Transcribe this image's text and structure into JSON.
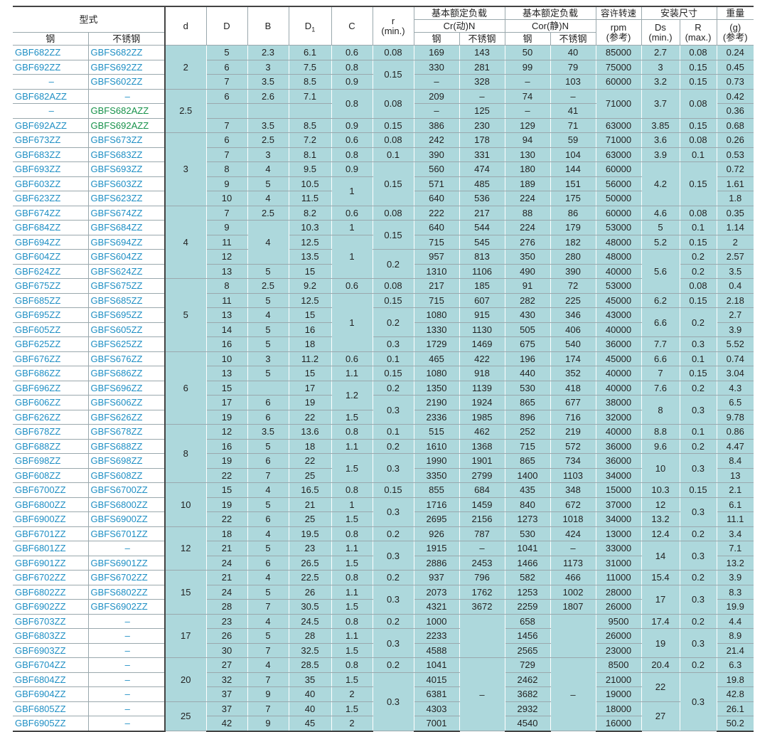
{
  "header": {
    "type": "型式",
    "steel": "钢",
    "stainless": "不锈钢",
    "d": "d",
    "D": "D",
    "B": "B",
    "D1": "D",
    "D1_sub": "1",
    "C": "C",
    "r": "r",
    "r_unit": "(min.)",
    "dyn_load": "基本额定负载",
    "cr": "Cr(动)N",
    "static_load": "基本额定负载",
    "cor": "Cor(静)N",
    "speed": "容许转速",
    "rpm": "rpm",
    "ref1": "(参考)",
    "mount": "安装尺寸",
    "ds": "Ds",
    "ds_unit": "(min.)",
    "R": "R",
    "R_unit": "(max.)",
    "weight": "重量",
    "g": "(g)",
    "ref2": "(参考)",
    "cr_steel": "钢",
    "cr_ss": "不锈钢",
    "cor_steel": "钢",
    "cor_ss": "不锈钢"
  },
  "dash": "–",
  "rows": [
    [
      "GBF682ZZ",
      "GBFS682ZZ",
      "2",
      "5",
      "2.3",
      "6.1",
      "0.6",
      "0.08",
      "169",
      "143",
      "50",
      "40",
      "85000",
      "2.7",
      "0.08",
      "0.24"
    ],
    [
      "GBF692ZZ",
      "GBFS692ZZ",
      "",
      "6",
      "3",
      "7.5",
      "0.8",
      "0.15",
      "330",
      "281",
      "99",
      "79",
      "75000",
      "3",
      "0.15",
      "0.45"
    ],
    [
      "–",
      "GBFS602ZZ",
      "",
      "7",
      "3.5",
      "8.5",
      "0.9",
      "",
      "–",
      "328",
      "–",
      "103",
      "60000",
      "3.2",
      "0.15",
      "0.73"
    ],
    [
      "GBF682AZZ",
      "–",
      "2.5",
      "6",
      "2.6",
      "7.1",
      "0.8",
      "0.08",
      "209",
      "–",
      "74",
      "–",
      "71000",
      "3.7",
      "0.08",
      "0.42"
    ],
    [
      "–",
      "GBFS682AZZ",
      "",
      "",
      "",
      "",
      "",
      "",
      "–",
      "125",
      "–",
      "41",
      "",
      "",
      "",
      "0.36"
    ],
    [
      "GBF692AZZ",
      "GBFS692AZZ",
      "",
      "7",
      "3.5",
      "8.5",
      "0.9",
      "0.15",
      "386",
      "230",
      "129",
      "71",
      "63000",
      "3.85",
      "0.15",
      "0.68"
    ],
    [
      "GBF673ZZ",
      "GBFS673ZZ",
      "3",
      "6",
      "2.5",
      "7.2",
      "0.6",
      "0.08",
      "242",
      "178",
      "94",
      "59",
      "71000",
      "3.6",
      "0.08",
      "0.26"
    ],
    [
      "GBF683ZZ",
      "GBFS683ZZ",
      "",
      "7",
      "3",
      "8.1",
      "0.8",
      "0.1",
      "390",
      "331",
      "130",
      "104",
      "63000",
      "3.9",
      "0.1",
      "0.53"
    ],
    [
      "GBF693ZZ",
      "GBFS693ZZ",
      "",
      "8",
      "4",
      "9.5",
      "0.9",
      "0.15",
      "560",
      "474",
      "180",
      "144",
      "60000",
      "4.2",
      "0.15",
      "0.72"
    ],
    [
      "GBF603ZZ",
      "GBFS603ZZ",
      "",
      "9",
      "5",
      "10.5",
      "1",
      "",
      "571",
      "485",
      "189",
      "151",
      "56000",
      "",
      "",
      "1.61"
    ],
    [
      "GBF623ZZ",
      "GBFS623ZZ",
      "",
      "10",
      "4",
      "11.5",
      "1",
      "",
      "640",
      "536",
      "224",
      "175",
      "50000",
      "",
      "",
      "1.8"
    ],
    [
      "GBF674ZZ",
      "GBFS674ZZ",
      "4",
      "7",
      "2.5",
      "8.2",
      "0.6",
      "0.08",
      "222",
      "217",
      "88",
      "86",
      "60000",
      "4.6",
      "0.08",
      "0.35"
    ],
    [
      "GBF684ZZ",
      "GBFS684ZZ",
      "",
      "9",
      "4",
      "10.3",
      "1",
      "0.15",
      "640",
      "544",
      "224",
      "179",
      "53000",
      "5",
      "0.1",
      "1.14"
    ],
    [
      "GBF694ZZ",
      "GBFS694ZZ",
      "",
      "11",
      "",
      "12.5",
      "1",
      "",
      "715",
      "545",
      "276",
      "182",
      "48000",
      "5.2",
      "0.15",
      "2"
    ],
    [
      "GBF604ZZ",
      "GBFS604ZZ",
      "",
      "12",
      "",
      "13.5",
      "",
      "0.2",
      "957",
      "813",
      "350",
      "280",
      "48000",
      "5.6",
      "0.2",
      "2.57"
    ],
    [
      "GBF624ZZ",
      "GBFS624ZZ",
      "",
      "13",
      "5",
      "15",
      "",
      "",
      "1310",
      "1106",
      "490",
      "390",
      "40000",
      "",
      "0.2",
      "3.5"
    ],
    [
      "GBF675ZZ",
      "GBFS675ZZ",
      "5",
      "8",
      "2.5",
      "9.2",
      "0.6",
      "0.08",
      "217",
      "185",
      "91",
      "72",
      "53000",
      "",
      "0.08",
      "0.4"
    ],
    [
      "GBF685ZZ",
      "GBFS685ZZ",
      "",
      "11",
      "5",
      "12.5",
      "1",
      "0.15",
      "715",
      "607",
      "282",
      "225",
      "45000",
      "6.2",
      "0.15",
      "2.18"
    ],
    [
      "GBF695ZZ",
      "GBFS695ZZ",
      "",
      "13",
      "4",
      "15",
      "",
      "0.2",
      "1080",
      "915",
      "430",
      "346",
      "43000",
      "6.6",
      "0.2",
      "2.7"
    ],
    [
      "GBF605ZZ",
      "GBFS605ZZ",
      "",
      "14",
      "5",
      "16",
      "",
      "",
      "1330",
      "1130",
      "505",
      "406",
      "40000",
      "",
      "",
      "3.9"
    ],
    [
      "GBF625ZZ",
      "GBFS625ZZ",
      "",
      "16",
      "5",
      "18",
      "",
      "0.3",
      "1729",
      "1469",
      "675",
      "540",
      "36000",
      "7.7",
      "0.3",
      "5.52"
    ],
    [
      "GBF676ZZ",
      "GBFS676ZZ",
      "6",
      "10",
      "3",
      "11.2",
      "0.6",
      "0.1",
      "465",
      "422",
      "196",
      "174",
      "45000",
      "6.6",
      "0.1",
      "0.74"
    ],
    [
      "GBF686ZZ",
      "GBFS686ZZ",
      "",
      "13",
      "5",
      "15",
      "1.1",
      "0.15",
      "1080",
      "918",
      "440",
      "352",
      "40000",
      "7",
      "0.15",
      "3.04"
    ],
    [
      "GBF696ZZ",
      "GBFS696ZZ",
      "",
      "15",
      "",
      "17",
      "1.2",
      "0.2",
      "1350",
      "1139",
      "530",
      "418",
      "40000",
      "7.6",
      "0.2",
      "4.3"
    ],
    [
      "GBF606ZZ",
      "GBFS606ZZ",
      "",
      "17",
      "6",
      "19",
      "",
      "0.3",
      "2190",
      "1924",
      "865",
      "677",
      "38000",
      "8",
      "0.3",
      "6.5"
    ],
    [
      "GBF626ZZ",
      "GBFS626ZZ",
      "",
      "19",
      "6",
      "22",
      "1.5",
      "",
      "2336",
      "1985",
      "896",
      "716",
      "32000",
      "",
      "",
      "9.78"
    ],
    [
      "GBF678ZZ",
      "GBFS678ZZ",
      "8",
      "12",
      "3.5",
      "13.6",
      "0.8",
      "0.1",
      "515",
      "462",
      "252",
      "219",
      "40000",
      "8.8",
      "0.1",
      "0.86"
    ],
    [
      "GBF688ZZ",
      "GBFS688ZZ",
      "",
      "16",
      "5",
      "18",
      "1.1",
      "0.2",
      "1610",
      "1368",
      "715",
      "572",
      "36000",
      "9.6",
      "0.2",
      "4.47"
    ],
    [
      "GBF698ZZ",
      "GBFS698ZZ",
      "",
      "19",
      "6",
      "22",
      "1.5",
      "0.3",
      "1990",
      "1901",
      "865",
      "734",
      "36000",
      "10",
      "0.3",
      "8.4"
    ],
    [
      "GBF608ZZ",
      "GBFS608ZZ",
      "",
      "22",
      "7",
      "25",
      "",
      "",
      "3350",
      "2799",
      "1400",
      "1103",
      "34000",
      "",
      "",
      "13"
    ],
    [
      "GBF6700ZZ",
      "GBFS6700ZZ",
      "10",
      "15",
      "4",
      "16.5",
      "0.8",
      "0.15",
      "855",
      "684",
      "435",
      "348",
      "15000",
      "10.3",
      "0.15",
      "2.1"
    ],
    [
      "GBF6800ZZ",
      "GBFS6800ZZ",
      "",
      "19",
      "5",
      "21",
      "1",
      "0.3",
      "1716",
      "1459",
      "840",
      "672",
      "37000",
      "12",
      "0.3",
      "6.1"
    ],
    [
      "GBF6900ZZ",
      "GBFS6900ZZ",
      "",
      "22",
      "6",
      "25",
      "1.5",
      "",
      "2695",
      "2156",
      "1273",
      "1018",
      "34000",
      "13.2",
      "",
      "11.1"
    ],
    [
      "GBF6701ZZ",
      "GBFS6701ZZ",
      "12",
      "18",
      "4",
      "19.5",
      "0.8",
      "0.2",
      "926",
      "787",
      "530",
      "424",
      "13000",
      "12.4",
      "0.2",
      "3.4"
    ],
    [
      "GBF6801ZZ",
      "–",
      "",
      "21",
      "5",
      "23",
      "1.1",
      "0.3",
      "1915",
      "–",
      "1041",
      "–",
      "33000",
      "14",
      "0.3",
      "7.1"
    ],
    [
      "GBF6901ZZ",
      "GBFS6901ZZ",
      "",
      "24",
      "6",
      "26.5",
      "1.5",
      "",
      "2886",
      "2453",
      "1466",
      "1173",
      "31000",
      "",
      "",
      "13.2"
    ],
    [
      "GBF6702ZZ",
      "GBFS6702ZZ",
      "15",
      "21",
      "4",
      "22.5",
      "0.8",
      "0.2",
      "937",
      "796",
      "582",
      "466",
      "11000",
      "15.4",
      "0.2",
      "3.9"
    ],
    [
      "GBF6802ZZ",
      "GBFS6802ZZ",
      "",
      "24",
      "5",
      "26",
      "1.1",
      "0.3",
      "2073",
      "1762",
      "1253",
      "1002",
      "28000",
      "17",
      "0.3",
      "8.3"
    ],
    [
      "GBF6902ZZ",
      "GBFS6902ZZ",
      "",
      "28",
      "7",
      "30.5",
      "1.5",
      "",
      "4321",
      "3672",
      "2259",
      "1807",
      "26000",
      "",
      "",
      "19.9"
    ],
    [
      "GBF6703ZZ",
      "–",
      "17",
      "23",
      "4",
      "24.5",
      "0.8",
      "0.2",
      "1000",
      "",
      "658",
      "",
      "9500",
      "17.4",
      "0.2",
      "4.4"
    ],
    [
      "GBF6803ZZ",
      "–",
      "",
      "26",
      "5",
      "28",
      "1.1",
      "0.3",
      "2233",
      "",
      "1456",
      "",
      "26000",
      "19",
      "0.3",
      "8.9"
    ],
    [
      "GBF6903ZZ",
      "–",
      "",
      "30",
      "7",
      "32.5",
      "1.5",
      "",
      "4588",
      "",
      "2565",
      "",
      "23000",
      "",
      "",
      "21.4"
    ],
    [
      "GBF6704ZZ",
      "–",
      "20",
      "27",
      "4",
      "28.5",
      "0.8",
      "0.2",
      "1041",
      "–",
      "729",
      "–",
      "8500",
      "20.4",
      "0.2",
      "6.3"
    ],
    [
      "GBF6804ZZ",
      "–",
      "",
      "32",
      "7",
      "35",
      "1.5",
      "0.3",
      "4015",
      "",
      "2462",
      "",
      "21000",
      "22",
      "0.3",
      "19.8"
    ],
    [
      "GBF6904ZZ",
      "–",
      "",
      "37",
      "9",
      "40",
      "2",
      "",
      "6381",
      "",
      "3682",
      "",
      "19000",
      "",
      "",
      "42.8"
    ],
    [
      "GBF6805ZZ",
      "–",
      "25",
      "37",
      "7",
      "40",
      "1.5",
      "",
      "4303",
      "",
      "2932",
      "",
      "18000",
      "27",
      "",
      "26.1"
    ],
    [
      "GBF6905ZZ",
      "–",
      "",
      "42",
      "9",
      "45",
      "2",
      "",
      "7001",
      "",
      "4540",
      "",
      "16000",
      "",
      "",
      "50.2"
    ]
  ]
}
